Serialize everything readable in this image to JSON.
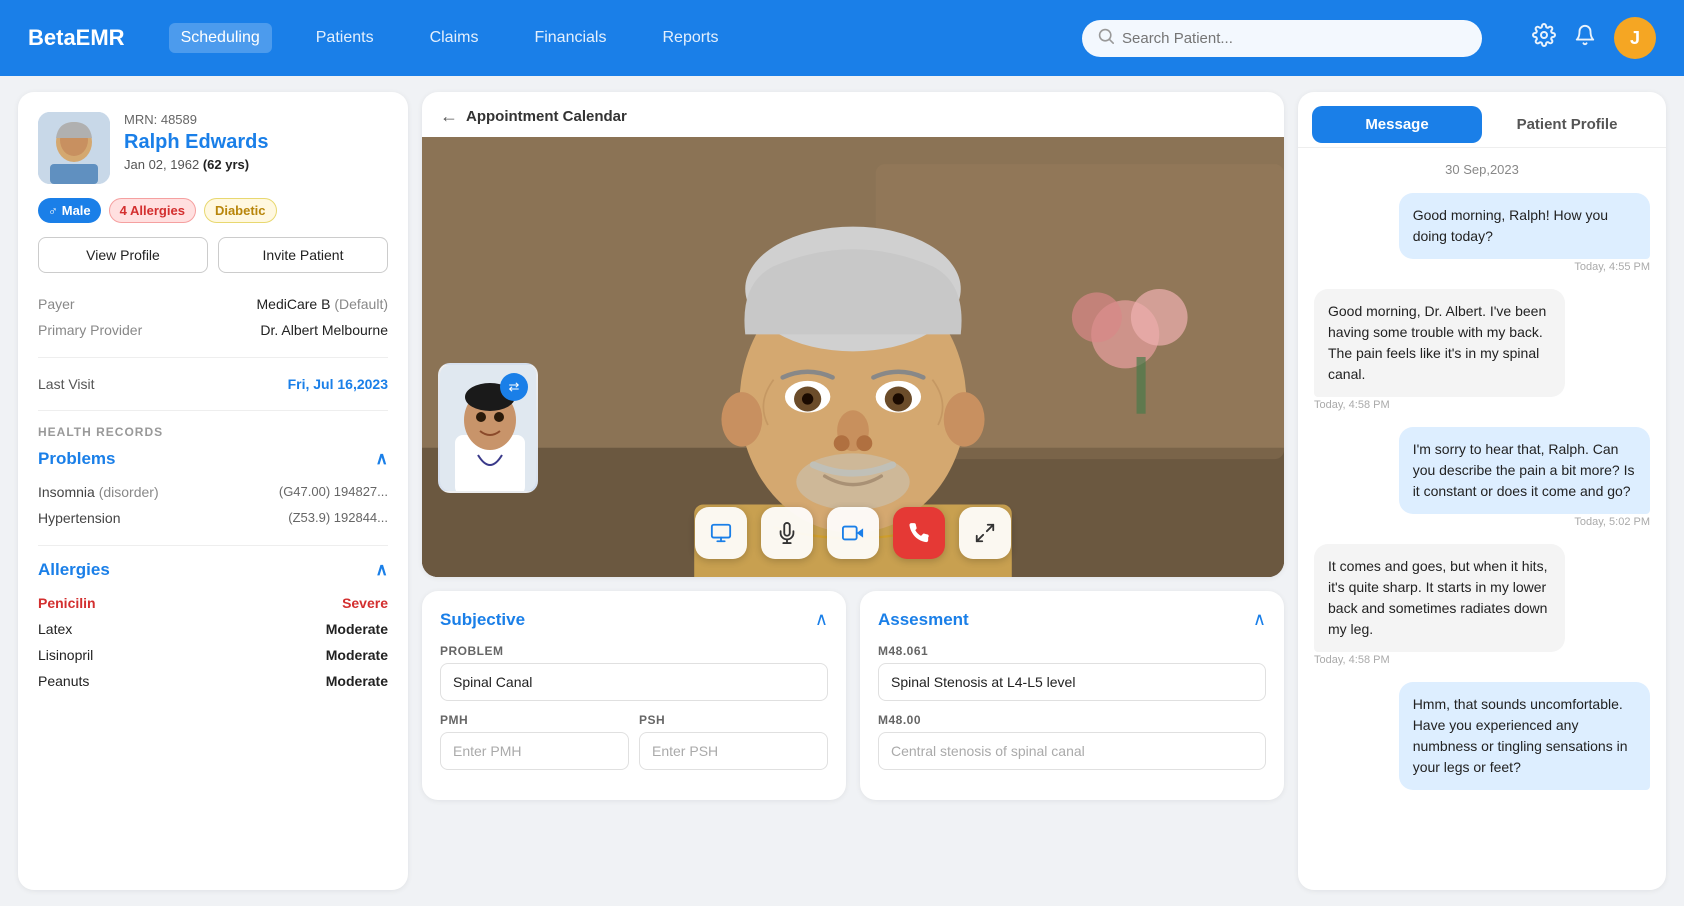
{
  "app": {
    "name": "BetaEMR"
  },
  "nav": {
    "links": [
      {
        "label": "Scheduling",
        "active": true
      },
      {
        "label": "Patients",
        "active": false
      },
      {
        "label": "Claims",
        "active": false
      },
      {
        "label": "Financials",
        "active": false
      },
      {
        "label": "Reports",
        "active": false
      }
    ],
    "search_placeholder": "Search Patient...",
    "user_initial": "J"
  },
  "patient": {
    "mrn_label": "MRN:",
    "mrn": "48589",
    "name": "Ralph Edwards",
    "dob": "Jan 02, 1962",
    "age": "62 yrs",
    "gender": "Male",
    "gender_icon": "♂",
    "allergies_count": "4 Allergies",
    "condition": "Diabetic",
    "view_profile_label": "View Profile",
    "invite_patient_label": "Invite Patient",
    "payer_label": "Payer",
    "payer_value": "MediCare B",
    "payer_default": "(Default)",
    "provider_label": "Primary Provider",
    "provider_value": "Dr. Albert Melbourne",
    "last_visit_label": "Last Visit",
    "last_visit_value": "Fri, Jul 16,2023"
  },
  "health_records": {
    "section_label": "HEALTH RECORDS",
    "problems_label": "Problems",
    "problems": [
      {
        "name": "Insomnia (disorder)",
        "code": "(G47.00)",
        "id": "194827..."
      },
      {
        "name": "Hypertension",
        "code": "(Z53.9)",
        "id": "192844..."
      }
    ],
    "allergies_label": "Allergies",
    "allergies": [
      {
        "name": "Penicilin",
        "severity": "Severe",
        "severe": true
      },
      {
        "name": "Latex",
        "severity": "Moderate",
        "severe": false
      },
      {
        "name": "Lisinopril",
        "severity": "Moderate",
        "severe": false
      },
      {
        "name": "Peanuts",
        "severity": "Moderate",
        "severe": false
      }
    ]
  },
  "video": {
    "back_label": "Appointment Calendar"
  },
  "subjective": {
    "title": "Subjective",
    "problem_label": "Problem",
    "problem_value": "Spinal Canal",
    "pmh_label": "PMH",
    "pmh_placeholder": "Enter PMH",
    "psh_label": "PSH",
    "psh_placeholder": "Enter PSH"
  },
  "assessment": {
    "title": "Assesment",
    "code1_label": "M48.061",
    "code1_value": "Spinal Stenosis at L4-L5 level",
    "code2_label": "M48.00",
    "code2_placeholder": "Central stenosis of spinal canal"
  },
  "chat": {
    "tabs": [
      {
        "label": "Message",
        "active": true
      },
      {
        "label": "Patient Profile",
        "active": false
      }
    ],
    "date": "30 Sep,2023",
    "messages": [
      {
        "type": "sent",
        "text": "Good morning, Ralph! How you doing today?",
        "time": "Today, 4:55 PM",
        "time_align": "right"
      },
      {
        "type": "received",
        "text": "Good morning, Dr. Albert. I've been having some trouble with my back. The pain feels like it's in my spinal canal.",
        "time": "Today, 4:58 PM",
        "time_align": "left"
      },
      {
        "type": "sent",
        "text": "I'm sorry to hear that, Ralph. Can you describe the pain a bit more? Is it constant or does it come and go?",
        "time": "Today, 5:02 PM",
        "time_align": "right"
      },
      {
        "type": "received",
        "text": "It comes and goes, but when it hits, it's quite sharp. It starts in my lower back and sometimes radiates down my leg.",
        "time": "Today, 4:58 PM",
        "time_align": "left"
      },
      {
        "type": "sent",
        "text": "Hmm, that sounds uncomfortable. Have you experienced any numbness or tingling sensations in your legs or feet?",
        "time": "",
        "time_align": "right"
      }
    ]
  }
}
